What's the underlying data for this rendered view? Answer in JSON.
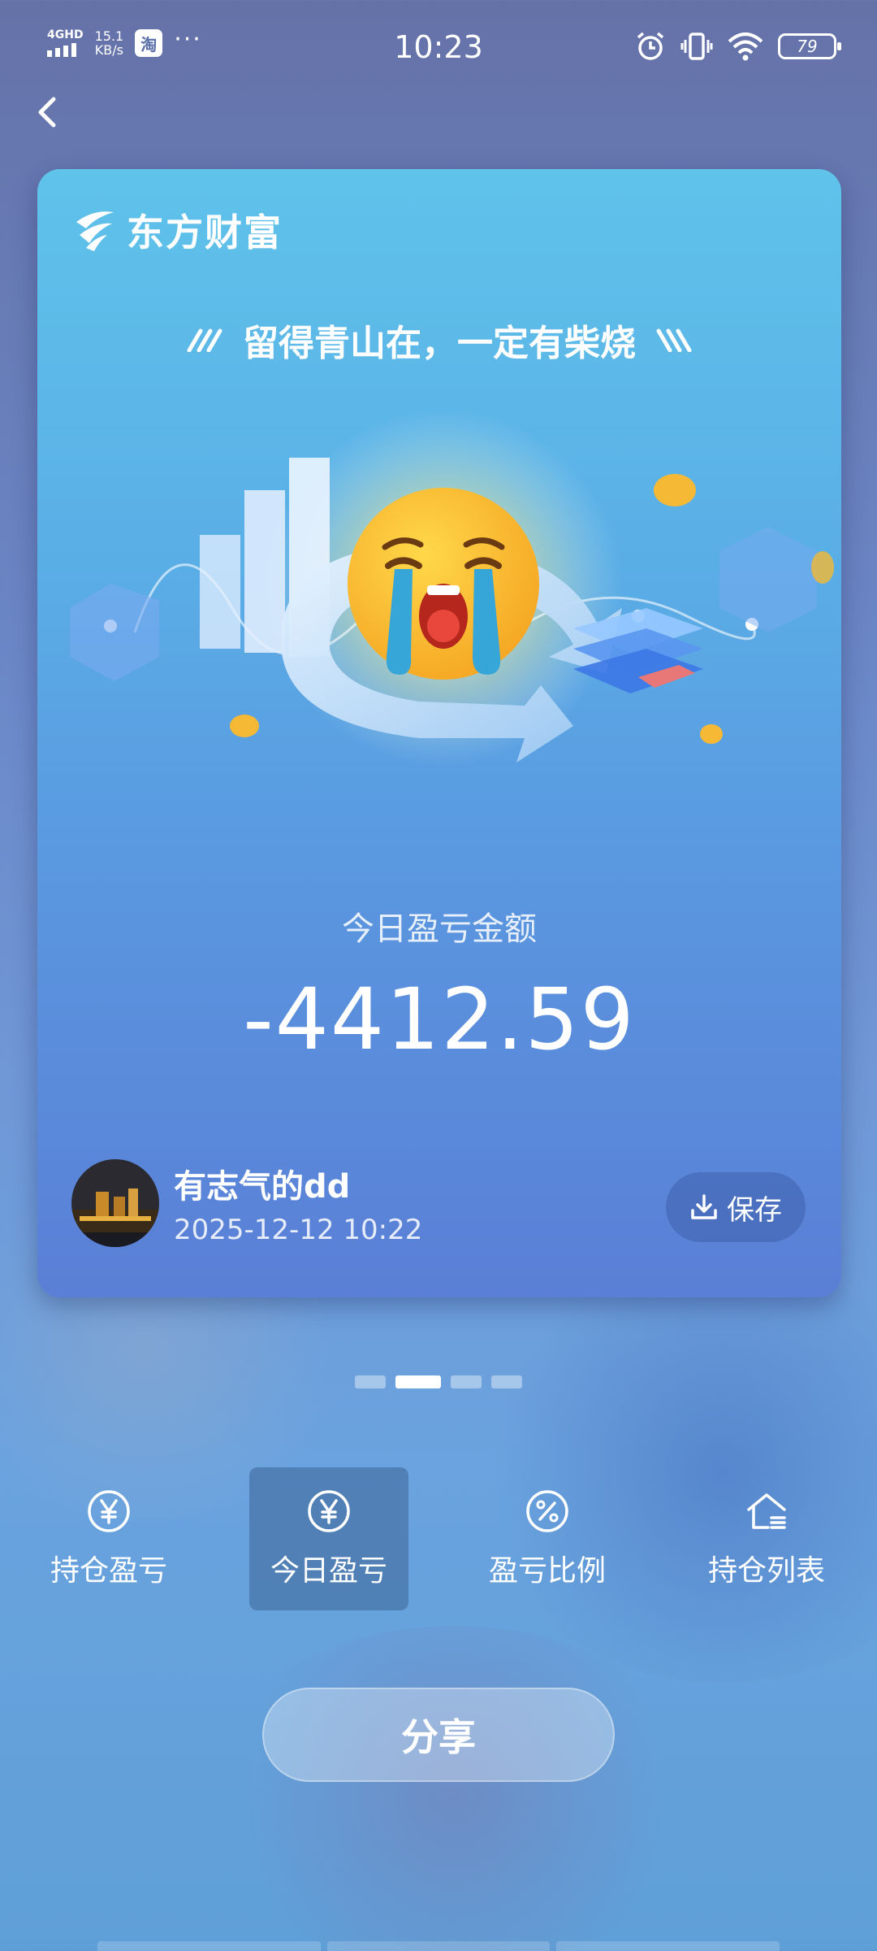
{
  "status_bar": {
    "network": "4GHD",
    "speed_value": "15.1",
    "speed_unit": "KB/s",
    "app_badge": "淘",
    "more": "···",
    "time": "10:23",
    "battery": "79"
  },
  "card": {
    "brand": "东方财富",
    "slogan": "留得青山在，一定有柴烧",
    "amount_label": "今日盈亏金额",
    "amount": "-4412.59",
    "user_name": "有志气的dd",
    "datetime": "2025-12-12 10:22",
    "save_label": "保存"
  },
  "pager": {
    "count": 4,
    "active_index": 1
  },
  "tabs": [
    {
      "label": "持仓盈亏",
      "icon": "yen-icon"
    },
    {
      "label": "今日盈亏",
      "icon": "yen-icon",
      "active": true
    },
    {
      "label": "盈亏比例",
      "icon": "percent-icon"
    },
    {
      "label": "持仓列表",
      "icon": "house-list-icon"
    }
  ],
  "share_label": "分享"
}
